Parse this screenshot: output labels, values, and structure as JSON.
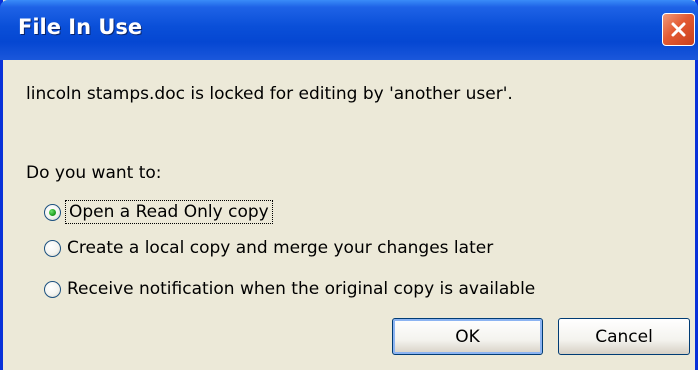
{
  "dialog": {
    "title": "File In Use",
    "message": "lincoln stamps.doc is locked for editing by 'another user'.",
    "prompt": "Do you want to:",
    "options": [
      {
        "label": "Open a Read Only copy",
        "selected": true
      },
      {
        "label": "Create a local copy and merge your changes later",
        "selected": false
      },
      {
        "label": "Receive notification when the original copy is available",
        "selected": false
      }
    ],
    "buttons": {
      "ok_label": "OK",
      "cancel_label": "Cancel"
    },
    "close_icon": "close-icon",
    "colors": {
      "titlebar": "#0a4fd8",
      "dialog_bg": "#ece9d8",
      "close_button": "#e35a32",
      "radio_selected": "#21a121"
    }
  }
}
